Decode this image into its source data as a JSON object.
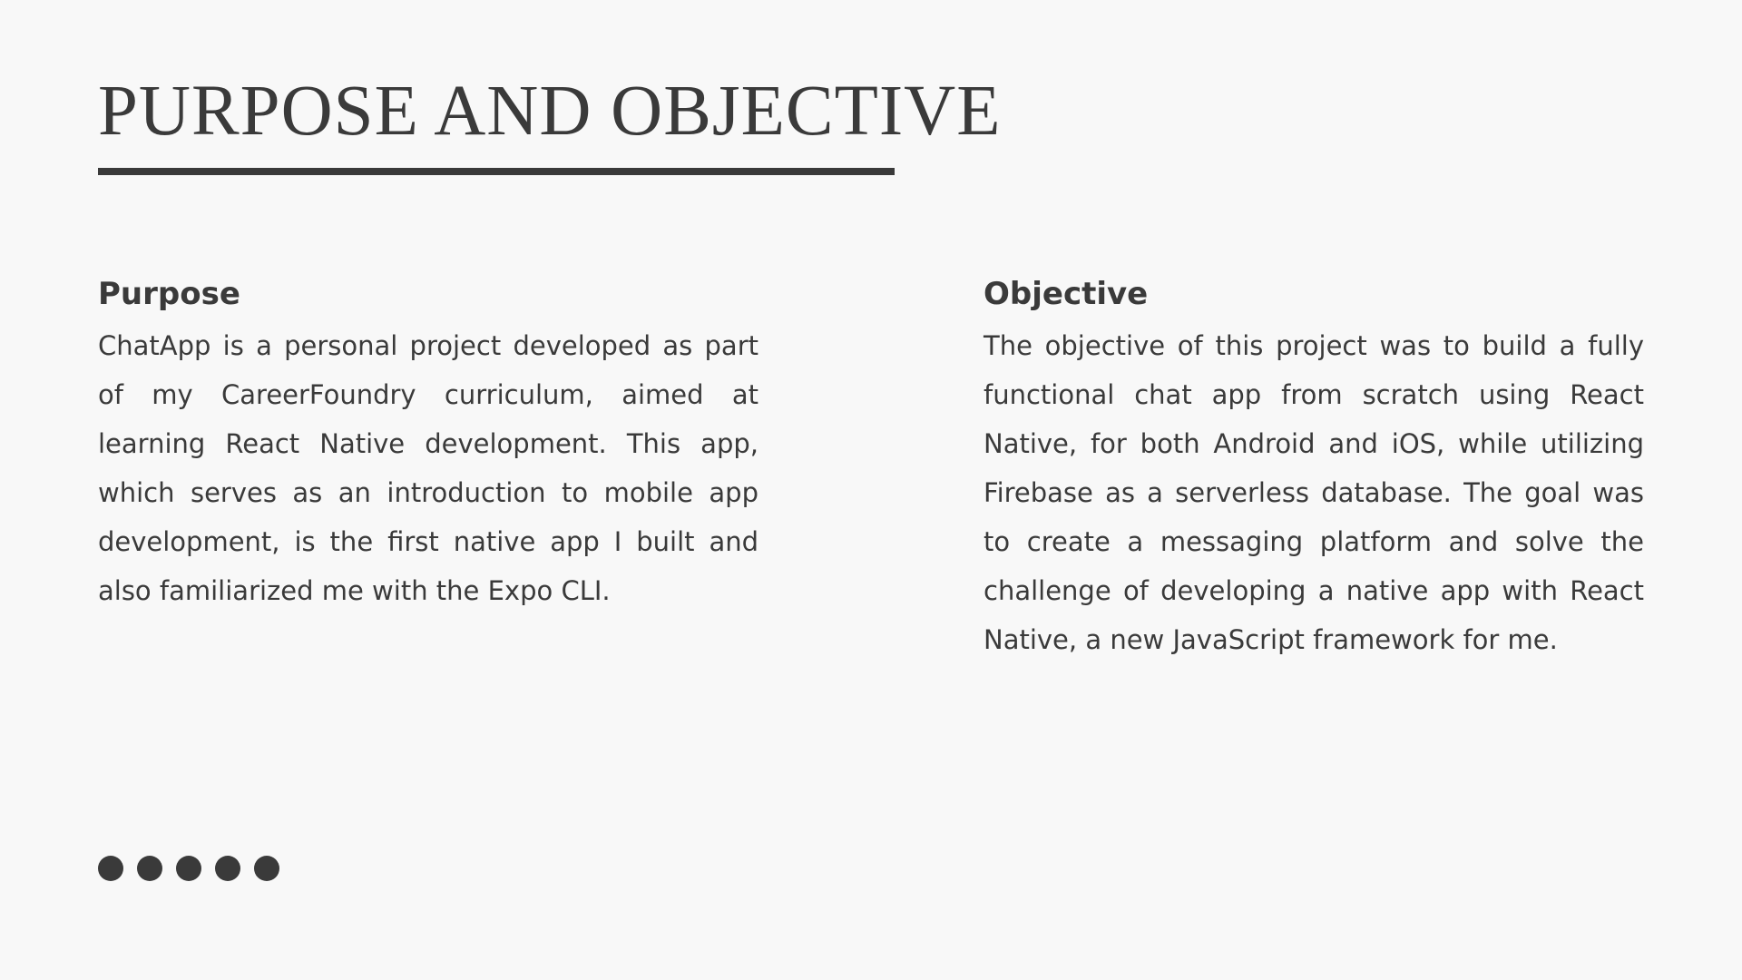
{
  "slide": {
    "title": "PURPOSE AND OBJECTIVE"
  },
  "purpose": {
    "heading": "Purpose",
    "body": "ChatApp is a personal project developed as part of my CareerFoundry curriculum, aimed at learning React Native development. This app, which serves as an introduction to mobile app development, is the first native app I built and also familiarized me with the Expo CLI."
  },
  "objective": {
    "heading": "Objective",
    "body": "The objective of this project was to build a fully functional chat app from scratch using React Native, for both Android and iOS, while utilizing Firebase as a serverless database. The goal was to create a messaging platform and solve the challenge of developing a native app with React Native, a new JavaScript framework for me."
  },
  "decoration": {
    "dot_count": 5,
    "color": "#3a3a3a"
  }
}
